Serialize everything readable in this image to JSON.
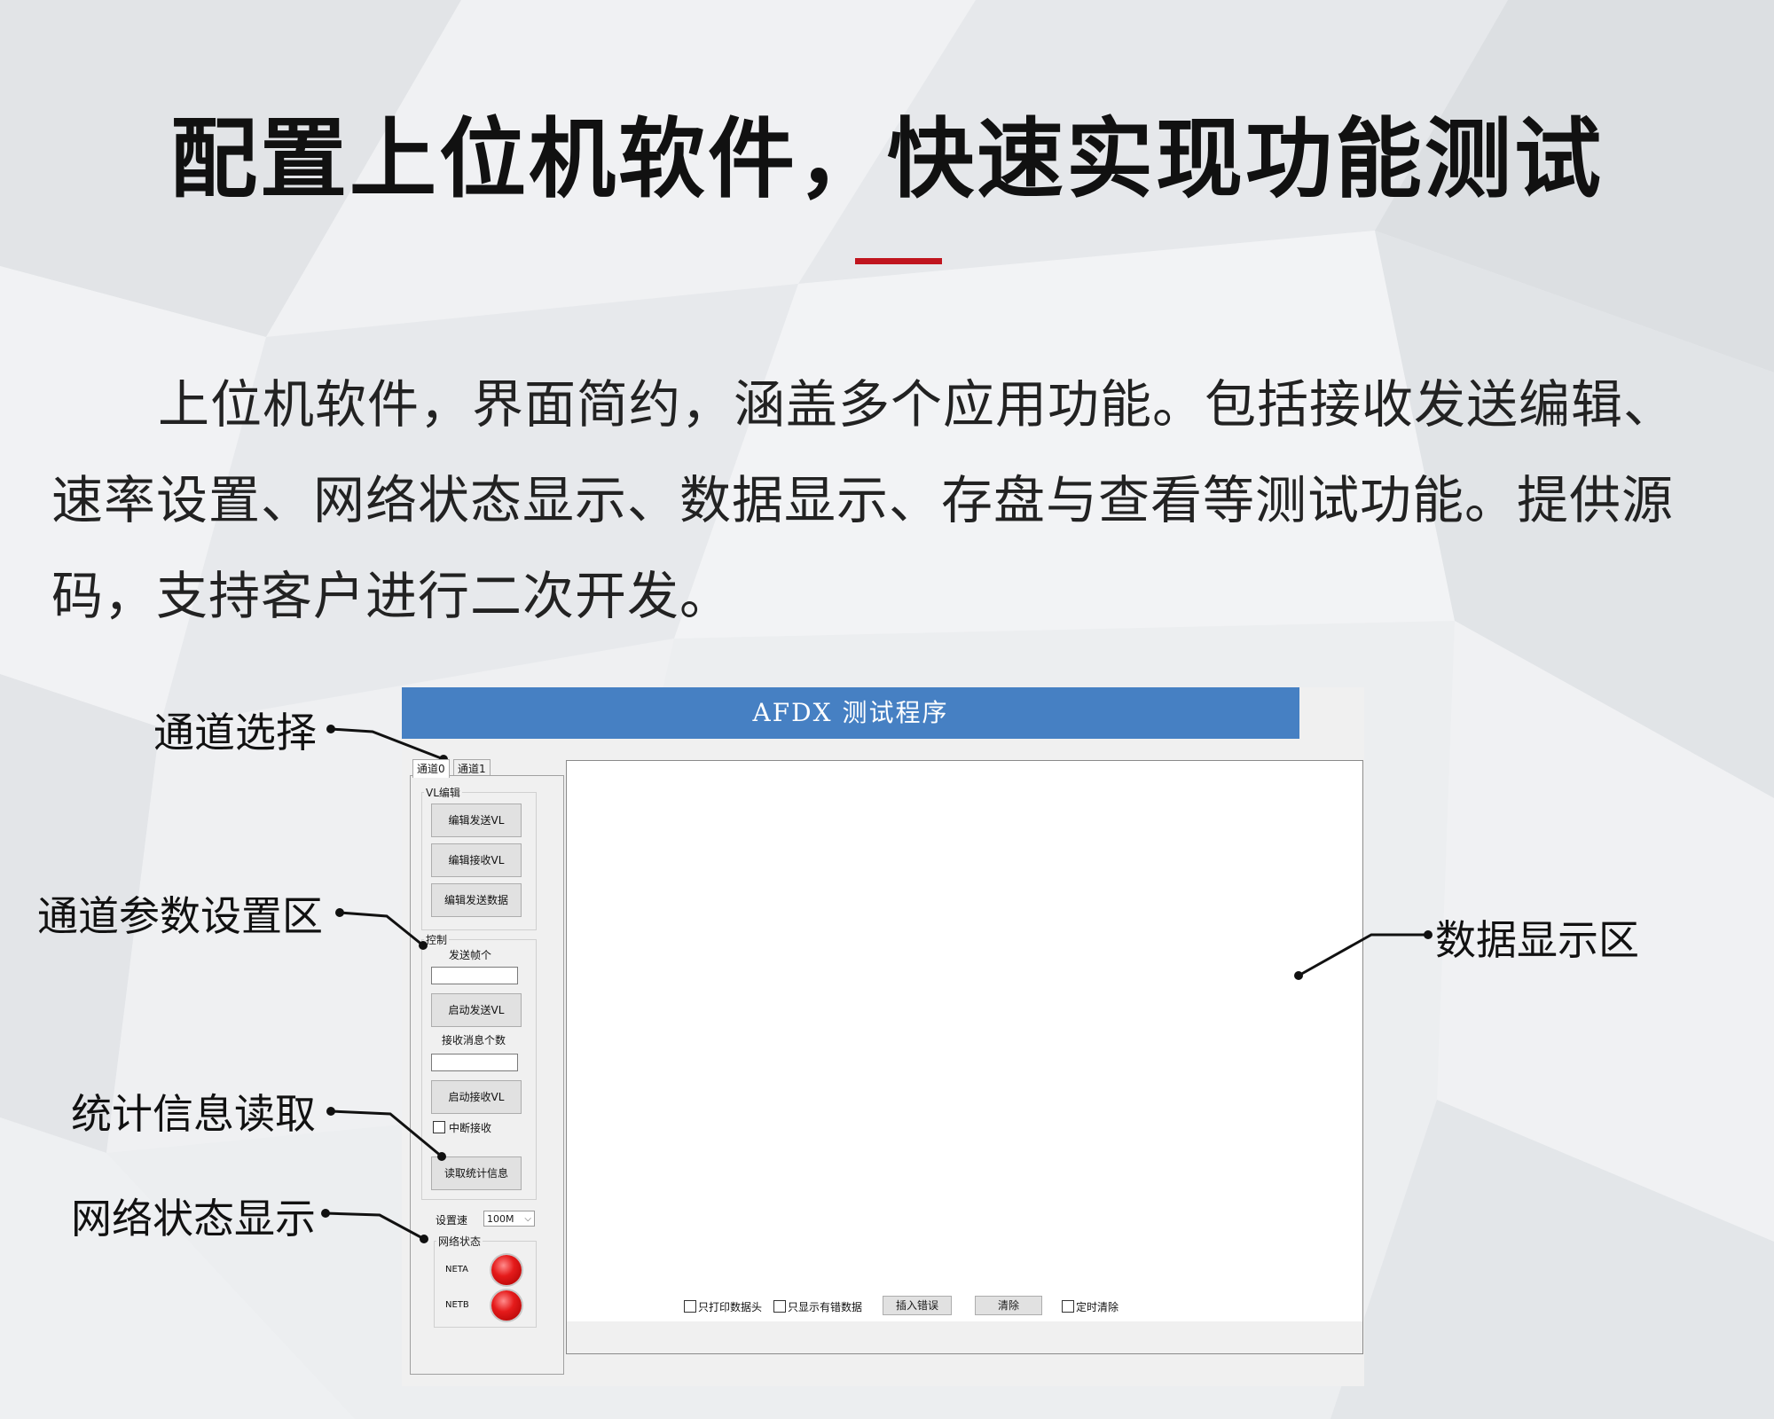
{
  "page": {
    "title": "配置上位机软件，快速实现功能测试",
    "paragraph_line1": "上位机软件，界面简约，涵盖多个应用功能。包括接收发送编辑、",
    "paragraph_line2": "速率设置、网络状态显示、数据显示、存盘与查看等测试功能。提供源",
    "paragraph_line3": "码，支持客户进行二次开发。",
    "accent_color": "#c0151e"
  },
  "callouts": {
    "channel_select": "通道选择",
    "channel_params": "通道参数设置区",
    "stats_read": "统计信息读取",
    "net_status": "网络状态显示",
    "data_area": "数据显示区"
  },
  "app": {
    "title": "AFDX 测试程序",
    "title_bar_color": "#4680c3",
    "tabs": [
      "通道0",
      "通道1"
    ],
    "vl_group": {
      "label": "VL编辑",
      "buttons": [
        "编辑发送VL",
        "编辑接收VL",
        "编辑发送数据"
      ]
    },
    "control_group": {
      "label": "控制",
      "send_frames_label": "发送帧个",
      "send_frames_value": "",
      "start_send_button": "启动发送VL",
      "recv_count_label": "接收消息个数",
      "recv_count_value": "",
      "start_recv_button": "启动接收VL",
      "interrupt_recv_label": "中断接收",
      "read_stats_button": "读取统计信息"
    },
    "speed": {
      "label": "设置速",
      "selected": "100M"
    },
    "net_group": {
      "label": "网络状态",
      "items": [
        {
          "name": "NETA",
          "status_color": "#e51b1b"
        },
        {
          "name": "NETB",
          "status_color": "#e51b1b"
        }
      ]
    },
    "toolbar": {
      "print_header_only": "只打印数据头",
      "show_error_only": "只显示有错数据",
      "insert_error_button": "插入错误",
      "clear_button": "清除",
      "timed_clear": "定时清除"
    }
  }
}
